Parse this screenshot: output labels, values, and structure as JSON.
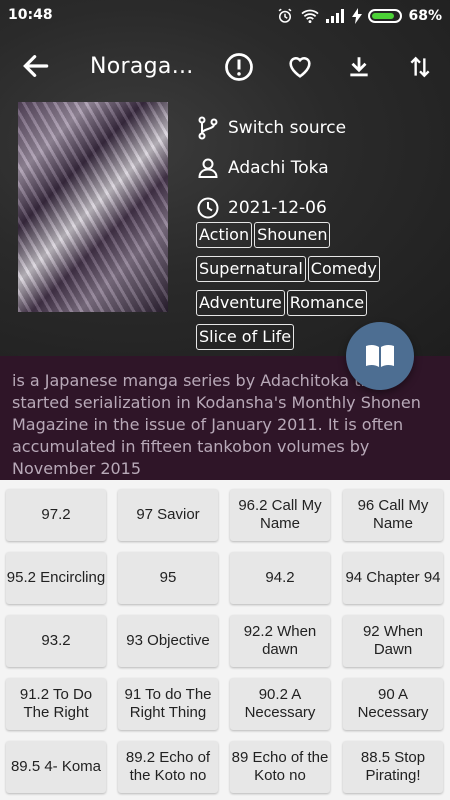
{
  "status": {
    "time": "10:48",
    "battery": "68%"
  },
  "toolbar": {
    "title": "Noraga..."
  },
  "info": {
    "source": "Switch source",
    "author": "Adachi Toka",
    "date": "2021-12-06"
  },
  "tags": [
    "Action",
    "Shounen",
    "Supernatural",
    "Comedy",
    "Adventure",
    "Romance",
    "Slice of Life"
  ],
  "description": "is a Japanese manga series by Adachitoka that started serialization in Kodansha's Monthly Shonen Magazine in the issue of January 2011. It is often accumulated in fifteen tankobon volumes by November 2015",
  "chapters": [
    "97.2",
    "97 Savior",
    "96.2 Call My Name",
    "96 Call My Name",
    "95.2 Encircling",
    "95",
    "94.2",
    "94 Chapter 94",
    "93.2",
    "93 Objective",
    "92.2 When dawn",
    "92 When Dawn",
    "91.2 To Do The Right",
    "91 To do The Right Thing",
    "90.2 A Necessary",
    "90 A Necessary",
    "89.5 4- Koma",
    "89.2 Echo of the Koto no",
    "89 Echo of the Koto no",
    "88.5 Stop Pirating!"
  ],
  "colors": {
    "fab": "#4d6e92",
    "description_bg": "#2f1528",
    "battery": "#4cd137"
  }
}
